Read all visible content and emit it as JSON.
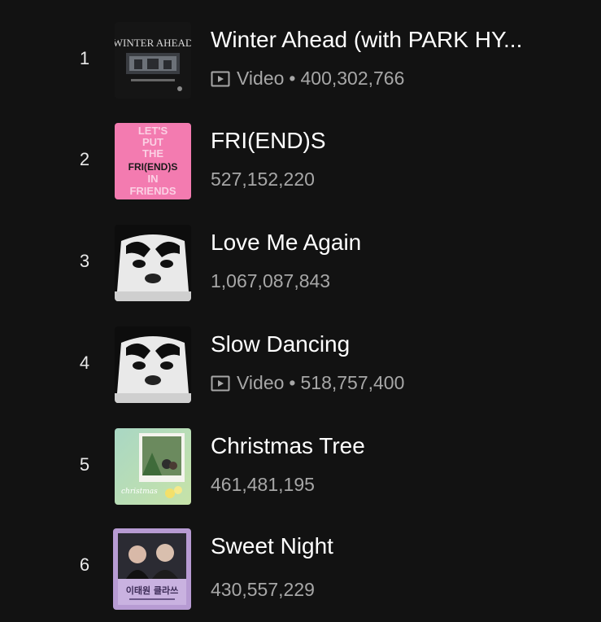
{
  "tracks": [
    {
      "rank": "1",
      "title": "Winter Ahead (with PARK HY...",
      "type": "Video",
      "plays": "400,302,766",
      "cover_text": "WINTER AHEAD"
    },
    {
      "rank": "2",
      "title": "FRI(END)S",
      "plays": "527,152,220",
      "cover_lines": [
        "LET'S",
        "PUT",
        "THE",
        "FRI(END)S",
        "IN",
        "FRIENDS"
      ]
    },
    {
      "rank": "3",
      "title": "Love Me Again",
      "plays": "1,067,087,843"
    },
    {
      "rank": "4",
      "title": "Slow Dancing",
      "type": "Video",
      "plays": "518,757,400"
    },
    {
      "rank": "5",
      "title": "Christmas Tree",
      "plays": "461,481,195"
    },
    {
      "rank": "6",
      "title": "Sweet Night",
      "plays": "430,557,229",
      "cover_text": "이태원 클라쓰"
    }
  ],
  "separator": "•",
  "colors": {
    "background": "#121212",
    "title": "#ffffff",
    "meta": "#a7a7a7",
    "rank": "#e9e9e9",
    "friends_pink": "#f37bb0"
  }
}
